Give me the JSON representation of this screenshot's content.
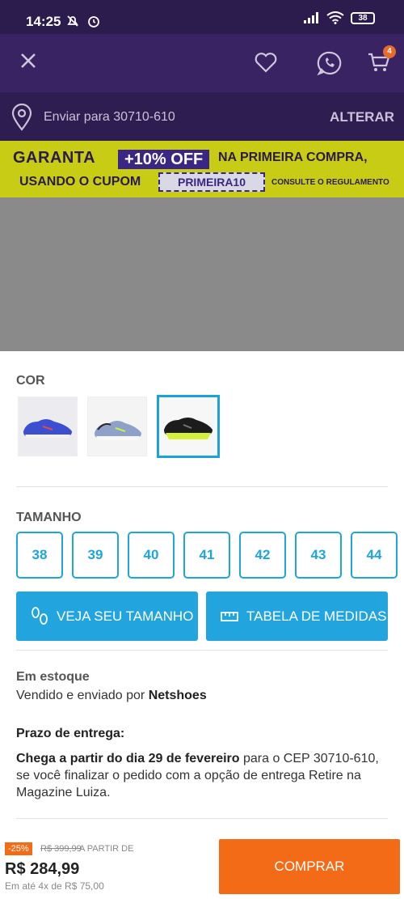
{
  "status_bar": {
    "time": "14:25",
    "battery": "38"
  },
  "header": {
    "cart_count": "4"
  },
  "address": {
    "label": "Enviar para 30710-610",
    "change": "ALTERAR"
  },
  "promo": {
    "line1_start": "GARANTA",
    "offer": "+10% OFF",
    "line1_end": "NA PRIMEIRA COMPRA,",
    "line2": "USANDO O CUPOM",
    "coupon": "PRIMEIRA10",
    "rules": "CONSULTE O REGULAMENTO"
  },
  "color_section": {
    "title": "COR",
    "swatches": [
      {
        "color": "blue",
        "selected": false
      },
      {
        "color": "grey",
        "selected": false
      },
      {
        "color": "black-yellow",
        "selected": true
      }
    ]
  },
  "size_section": {
    "title": "TAMANHO",
    "sizes": [
      "38",
      "39",
      "40",
      "41",
      "42",
      "43",
      "44"
    ]
  },
  "buttons": {
    "size_guide": "VEJA SEU TAMANHO",
    "measures": "TABELA DE MEDIDAS",
    "buy": "COMPRAR"
  },
  "stock": {
    "title": "Em estoque",
    "seller_prefix": "Vendido e enviado por",
    "seller": "Netshoes"
  },
  "delivery": {
    "title": "Prazo de entrega:",
    "bold": "Chega a partir do dia 29 de fevereiro",
    "text": " para o CEP 30710-610, se você finalizar o pedido com a opção de entrega Retire na Magazine Luiza."
  },
  "price": {
    "discount": "-25%",
    "old": "R$ 399,99",
    "from": "A PARTIR DE",
    "current": "R$ 284,99",
    "installments": "Em até 4x de R$ 75,00"
  },
  "colors": {
    "accent": "#1ea6d8",
    "buy": "#f36b16",
    "header": "#3a2363",
    "promo": "#c9cc14"
  }
}
